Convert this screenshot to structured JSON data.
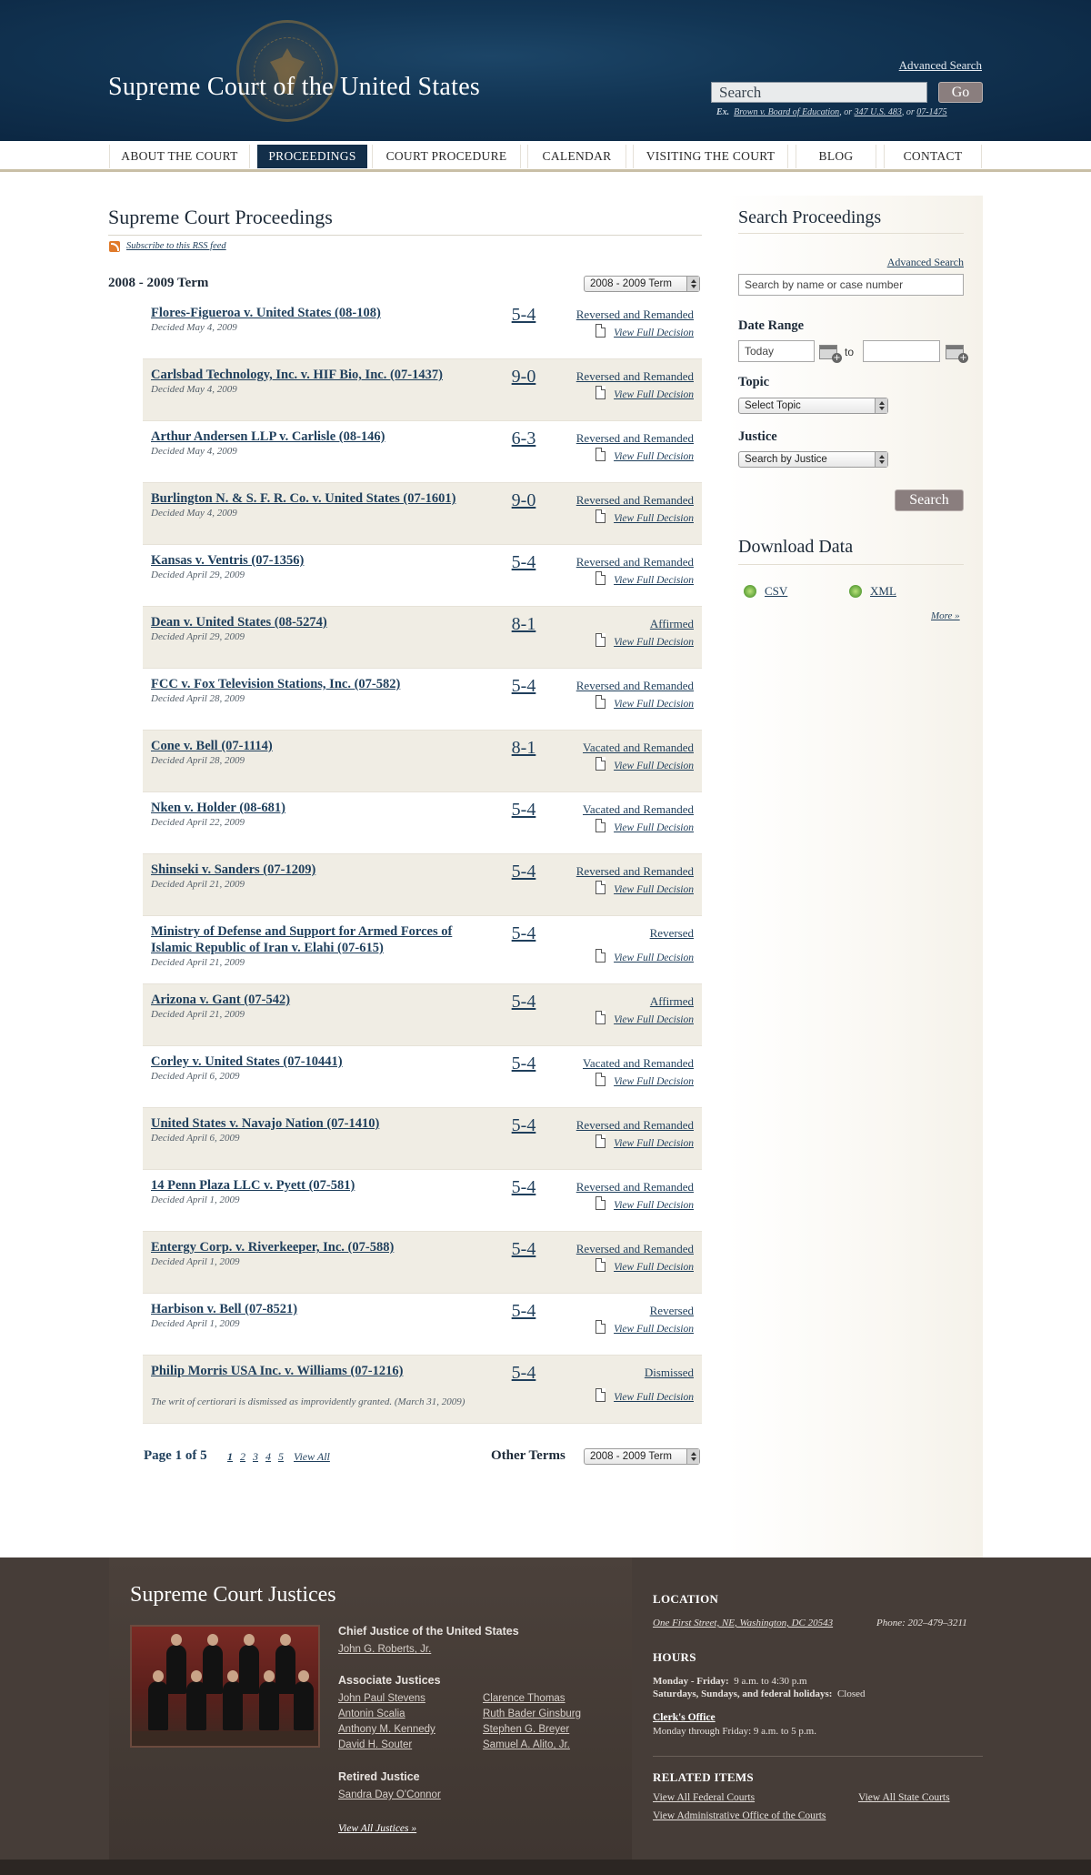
{
  "header": {
    "site_title": "Supreme Court of the United States",
    "advanced_search": "Advanced Search",
    "search_value": "Search",
    "go_label": "Go",
    "example_prefix": "Ex.",
    "example_1": "Brown v. Board of Education",
    "example_sep_1": ", or ",
    "example_2": "347 U.S. 483",
    "example_sep_2": ", or ",
    "example_3": "07-1475"
  },
  "nav": [
    "ABOUT THE COURT",
    "PROCEEDINGS",
    "COURT PROCEDURE",
    "CALENDAR",
    "VISITING THE COURT",
    "BLOG",
    "CONTACT"
  ],
  "nav_active_index": 1,
  "main": {
    "title": "Supreme Court Proceedings",
    "rss_link": "Subscribe to this RSS feed",
    "term_heading": "2008 - 2009 Term",
    "term_select": "2008 - 2009 Term",
    "view_full": "View Full Decision",
    "cases": [
      {
        "name": "Flores-Figueroa v. United States (08-108)",
        "date": "Decided May 4, 2009",
        "vote": "5-4",
        "outcome": "Reversed and Remanded"
      },
      {
        "name": "Carlsbad Technology, Inc. v. HIF Bio, Inc. (07-1437)",
        "date": "Decided May 4, 2009",
        "vote": "9-0",
        "outcome": "Reversed and Remanded"
      },
      {
        "name": "Arthur Andersen LLP v. Carlisle (08-146)",
        "date": "Decided May 4, 2009",
        "vote": "6-3",
        "outcome": "Reversed and Remanded"
      },
      {
        "name": "Burlington N. & S. F. R. Co. v. United States (07-1601)",
        "date": "Decided May 4, 2009",
        "vote": "9-0",
        "outcome": "Reversed and Remanded"
      },
      {
        "name": "Kansas v. Ventris (07-1356)",
        "date": "Decided April 29, 2009",
        "vote": "5-4",
        "outcome": "Reversed and Remanded"
      },
      {
        "name": "Dean v. United States (08-5274)",
        "date": "Decided April 29, 2009",
        "vote": "8-1",
        "outcome": "Affirmed"
      },
      {
        "name": "FCC v. Fox Television Stations, Inc. (07-582)",
        "date": "Decided April 28, 2009",
        "vote": "5-4",
        "outcome": "Reversed and Remanded"
      },
      {
        "name": "Cone v. Bell (07-1114)",
        "date": "Decided April 28, 2009",
        "vote": "8-1",
        "outcome": "Vacated and Remanded"
      },
      {
        "name": "Nken v. Holder (08-681)",
        "date": "Decided April 22, 2009",
        "vote": "5-4",
        "outcome": "Vacated and Remanded"
      },
      {
        "name": "Shinseki v. Sanders  (07-1209)",
        "date": "Decided April 21, 2009",
        "vote": "5-4",
        "outcome": "Reversed and Remanded"
      },
      {
        "name": "Ministry of Defense and Support for Armed Forces of Islamic Republic of Iran v. Elahi  (07-615)",
        "date": "Decided April 21, 2009",
        "vote": "5-4",
        "outcome": "Reversed"
      },
      {
        "name": "Arizona v. Gant (07-542)",
        "date": "Decided April 21, 2009",
        "vote": "5-4",
        "outcome": "Affirmed"
      },
      {
        "name": "Corley v. United States (07-10441)",
        "date": "Decided April 6, 2009",
        "vote": "5-4",
        "outcome": "Vacated and Remanded"
      },
      {
        "name": "United States v. Navajo Nation (07-1410)",
        "date": "Decided April 6, 2009",
        "vote": "5-4",
        "outcome": "Reversed and Remanded"
      },
      {
        "name": "14 Penn Plaza LLC v. Pyett  (07-581)",
        "date": "Decided April 1, 2009",
        "vote": "5-4",
        "outcome": "Reversed and Remanded"
      },
      {
        "name": "Entergy Corp. v. Riverkeeper, Inc. (07-588)",
        "date": "Decided April 1, 2009",
        "vote": "5-4",
        "outcome": "Reversed and Remanded"
      },
      {
        "name": "Harbison v. Bell  (07-8521)",
        "date": "Decided April 1, 2009",
        "vote": "5-4",
        "outcome": "Reversed"
      },
      {
        "name": "Philip Morris USA Inc. v. Williams (07-1216)",
        "date": "The writ of certiorari is dismissed as improvidently granted. (March 31, 2009)",
        "vote": "5-4",
        "outcome": "Dismissed"
      }
    ],
    "pager_label": "Page 1 of 5",
    "pages": [
      "1",
      "2",
      "3",
      "4",
      "5"
    ],
    "view_all": "View All",
    "other_terms": "Other Terms",
    "other_terms_select": "2008 - 2009 Term"
  },
  "sidebar": {
    "title": "Search Proceedings",
    "advanced_search": "Advanced Search",
    "name_placeholder": "Search by name or case number",
    "date_range_label": "Date Range",
    "date_from": "Today",
    "to_label": "to",
    "date_to": "",
    "topic_label": "Topic",
    "topic_select": "Select Topic",
    "justice_label": "Justice",
    "justice_select": "Search by Justice",
    "search_button": "Search",
    "download_title": "Download Data",
    "csv": "CSV",
    "xml": "XML",
    "more": "More »"
  },
  "footer": {
    "justices_title": "Supreme Court Justices",
    "chief_label": "Chief Justice of the United States",
    "chief_name": "John G. Roberts, Jr.",
    "associate_label": "Associate Justices",
    "associates_col1": [
      "John Paul Stevens",
      "Antonin Scalia",
      "Anthony M. Kennedy",
      "David H. Souter"
    ],
    "associates_col2": [
      "Clarence Thomas",
      "Ruth Bader Ginsburg",
      "Stephen G. Breyer",
      "Samuel A. Alito, Jr."
    ],
    "retired_label": "Retired Justice",
    "retired_name": "Sandra Day O'Connor",
    "view_all_justices": "View All Justices »",
    "location_head": "LOCATION",
    "address": "One First Street, NE, Washington, DC 20543",
    "phone": "Phone: 202–479–3211",
    "hours_head": "HOURS",
    "hours_weekday_label": "Monday - Friday:",
    "hours_weekday": "9 a.m. to 4:30 p.m",
    "hours_weekend_label": "Saturdays, Sundays, and federal holidays:",
    "hours_weekend": "Closed",
    "clerk_link": "Clerk's Office",
    "clerk_hours": "Monday through Friday: 9 a.m. to 5 p.m.",
    "related_head": "RELATED ITEMS",
    "related_1": "View All Federal Courts",
    "related_2": "View All State Courts",
    "related_3": "View Administrative Office of the Courts"
  }
}
